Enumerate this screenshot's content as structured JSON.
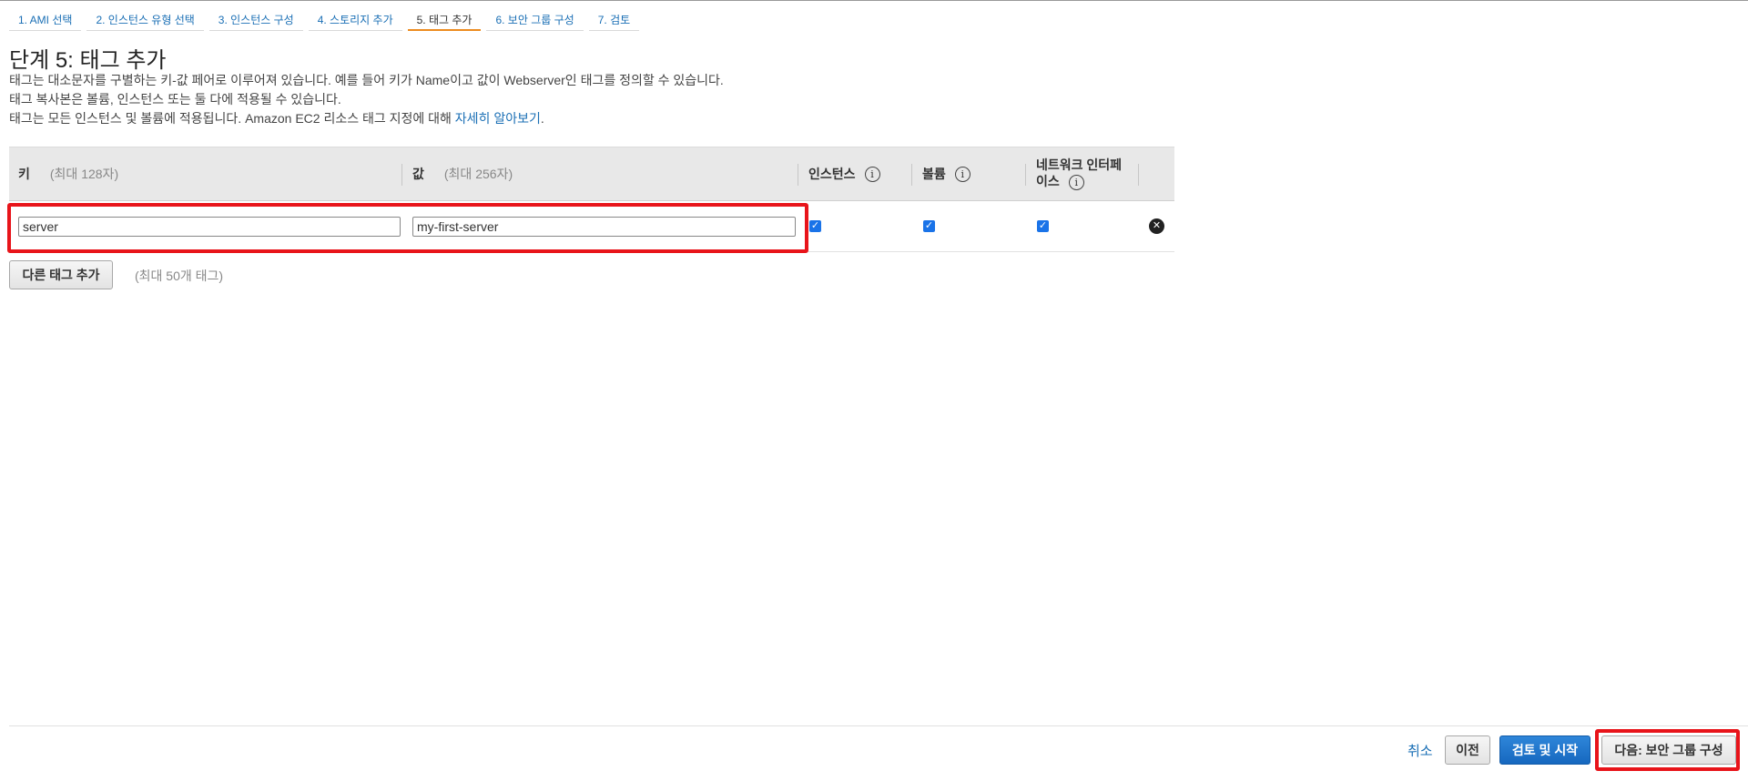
{
  "steps": [
    {
      "label": "1. AMI 선택",
      "active": false
    },
    {
      "label": "2. 인스턴스 유형 선택",
      "active": false
    },
    {
      "label": "3. 인스턴스 구성",
      "active": false
    },
    {
      "label": "4. 스토리지 추가",
      "active": false
    },
    {
      "label": "5. 태그 추가",
      "active": true
    },
    {
      "label": "6. 보안 그룹 구성",
      "active": false
    },
    {
      "label": "7. 검토",
      "active": false
    }
  ],
  "page": {
    "title": "단계 5: 태그 추가",
    "desc_line1": "태그는 대소문자를 구별하는 키-값 페어로 이루어져 있습니다. 예를 들어 키가 Name이고 값이 Webserver인 태그를 정의할 수 있습니다.",
    "desc_line2": "태그 복사본은 볼륨, 인스턴스 또는 둘 다에 적용될 수 있습니다.",
    "desc_line3": "태그는 모든 인스턴스 및 볼륨에 적용됩니다. Amazon EC2 리소스 태그 지정에 대해 ",
    "learn_more": "자세히 알아보기",
    "desc_line3_end": "."
  },
  "table": {
    "key_header": "키",
    "key_hint": "(최대 128자)",
    "value_header": "값",
    "value_hint": "(최대 256자)",
    "instances_header": "인스턴스",
    "volumes_header": "볼륨",
    "network_header_line1": "네트워크 인터페",
    "network_header_line2": "이스",
    "info_glyph": "i",
    "rows": [
      {
        "key": "server",
        "value": "my-first-server",
        "instances": true,
        "volumes": true,
        "network": true
      }
    ],
    "check_glyph": "✓",
    "remove_glyph": "✕"
  },
  "add_tag_button": "다른 태그 추가",
  "add_tag_hint": "(최대 50개 태그)",
  "footer": {
    "cancel": "취소",
    "previous": "이전",
    "review_launch": "검토 및 시작",
    "next": "다음: 보안 그룹 구성"
  },
  "colors": {
    "link": "#1a6fb5",
    "active_step_underline": "#ec8b1f",
    "primary_button": "#1668bf",
    "highlight_box": "#e8141a",
    "checkbox": "#1a73e8"
  }
}
